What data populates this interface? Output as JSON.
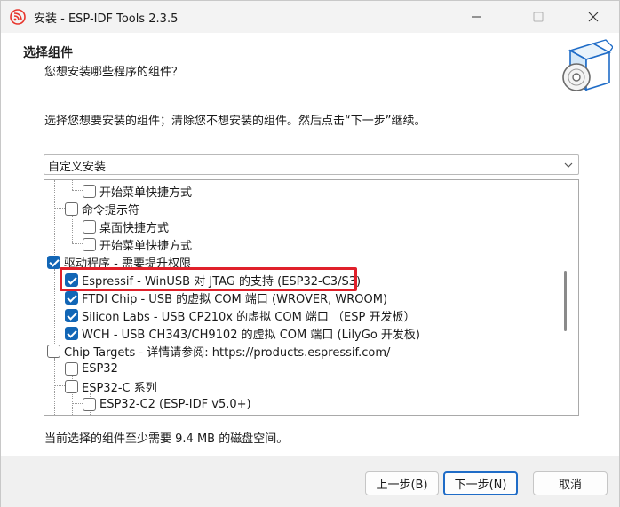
{
  "window": {
    "title": "安装 - ESP-IDF Tools 2.3.5",
    "icons": {
      "app": "espressif-logo-icon",
      "minimize": "minimize-icon",
      "maximize": "maximize-icon",
      "close": "close-icon"
    }
  },
  "header": {
    "title": "选择组件",
    "subtitle": "您想安装哪些程序的组件？",
    "art": "software-box-cd-icon"
  },
  "instruction": "选择您想要安装的组件；清除您不想安装的组件。然后点击“下一步”继续。",
  "install_type": {
    "selected": "自定义安装"
  },
  "tree": {
    "items": [
      {
        "label": "开始菜单快捷方式",
        "checked": false
      },
      {
        "label": "命令提示符",
        "checked": false
      },
      {
        "label": "桌面快捷方式",
        "checked": false
      },
      {
        "label": "开始菜单快捷方式",
        "checked": false
      },
      {
        "label": "驱动程序 - 需要提升权限",
        "checked": true
      },
      {
        "label": "Espressif - WinUSB 对 JTAG 的支持 (ESP32-C3/S3)",
        "checked": true
      },
      {
        "label": "FTDI Chip - USB 的虚拟 COM 端口 (WROVER, WROOM)",
        "checked": true
      },
      {
        "label": "Silicon Labs - USB CP210x 的虚拟 COM 端口 （ESP 开发板）",
        "checked": true
      },
      {
        "label": "WCH - USB CH343/CH9102 的虚拟 COM 端口 (LilyGo 开发板)",
        "checked": true
      },
      {
        "label": "Chip Targets - 详情请参阅: https://products.espressif.com/",
        "checked": false
      },
      {
        "label": "ESP32",
        "checked": false
      },
      {
        "label": "ESP32-C 系列",
        "checked": false
      },
      {
        "label": "ESP32-C2 (ESP-IDF v5.0+)",
        "checked": false
      }
    ]
  },
  "disk_space": "当前选择的组件至少需要 9.4 MB 的磁盘空间。",
  "buttons": {
    "back": "上一步(B)",
    "next": "下一步(N)",
    "cancel": "取消"
  },
  "colors": {
    "accent": "#1266b6",
    "highlight": "#e0202a"
  }
}
